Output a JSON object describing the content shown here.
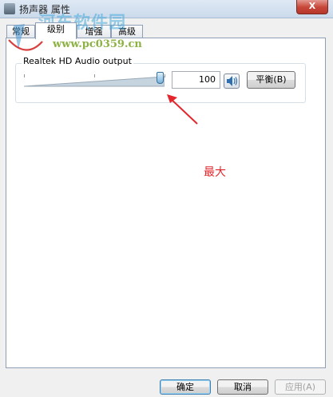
{
  "window": {
    "title": "扬声器 属性",
    "close_label": "X"
  },
  "tabs": [
    {
      "label": "常规"
    },
    {
      "label": "级别"
    },
    {
      "label": "增强"
    },
    {
      "label": "高级"
    }
  ],
  "active_tab": "级别",
  "device": {
    "name": "Realtek HD Audio output",
    "volume_value": "100",
    "volume_level": 1.0,
    "balance_label": "平衡(B)",
    "speaker_icon": "speaker-volume-icon"
  },
  "annotation": {
    "text": "最大",
    "color": "#e2262c"
  },
  "watermark": {
    "title": "河东软件园",
    "url": "www.pc0359.cn"
  },
  "buttons": {
    "ok": "确定",
    "cancel": "取消",
    "apply": "应用(A)"
  }
}
